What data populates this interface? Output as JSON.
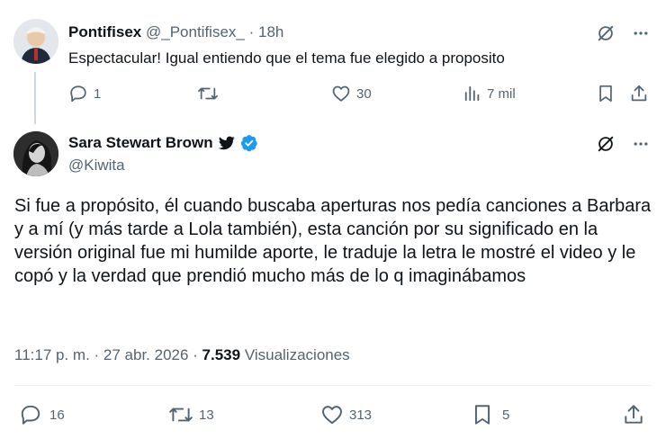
{
  "reply": {
    "name": "Pontifisex",
    "handle": "@_Pontifisex_",
    "separator": "·",
    "time": "18h",
    "text": "Espectacular! Igual entiendo que el tema fue elegido a proposito",
    "replies": "1",
    "retweets": "",
    "likes": "30",
    "views": "7 mil"
  },
  "main": {
    "name": "Sara Stewart Brown",
    "handle": "@Kiwita",
    "text": "Si fue a propósito, él cuando buscaba aperturas nos pedía canciones a Barbara y a mí (y más tarde a Lola también), esta canción por su significado en la versión original fue mi humilde aporte, le traduje la letra le mostré el video y le copó y la verdad que prendió mucho más de lo q imaginábamos",
    "time": "11:17 p. m.",
    "dot1": " · ",
    "date": "27 abr. 2026",
    "dot2": " · ",
    "views": "7.539",
    "views_label": " Visualizaciones",
    "replies": "16",
    "retweets": "13",
    "likes": "313",
    "bookmarks": "5"
  },
  "colors": {
    "verified": "#1d9bf0",
    "muted": "#536471",
    "text": "#0f1419"
  },
  "icons": [
    "grok-icon",
    "more-icon",
    "reply-icon",
    "retweet-icon",
    "like-icon",
    "views-icon",
    "bookmark-icon",
    "share-icon",
    "bird-icon",
    "verified-badge-icon"
  ]
}
